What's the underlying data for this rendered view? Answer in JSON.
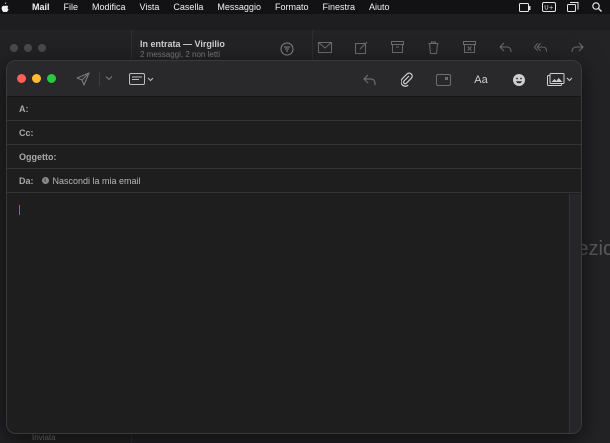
{
  "menubar": {
    "app": "Mail",
    "items": [
      "File",
      "Modifica",
      "Vista",
      "Casella",
      "Messaggio",
      "Formato",
      "Finestra",
      "Aiuto"
    ],
    "status_badge": "U+"
  },
  "background": {
    "mailbox_title": "In entrata — Virgilio",
    "mailbox_subtitle": "2 messaggi, 2 non letti",
    "sidebar_bottom": "Inviata",
    "peek_text": "ezic"
  },
  "compose": {
    "to_label": "A:",
    "cc_label": "Cc:",
    "subject_label": "Oggetto:",
    "from_label": "Da:",
    "from_value": "Nascondi la mia email",
    "font_button": "Aa"
  },
  "colors": {
    "accent": "#2f7bff",
    "close": "#fe5f57",
    "minimize": "#febc2e",
    "zoom": "#28c840"
  }
}
